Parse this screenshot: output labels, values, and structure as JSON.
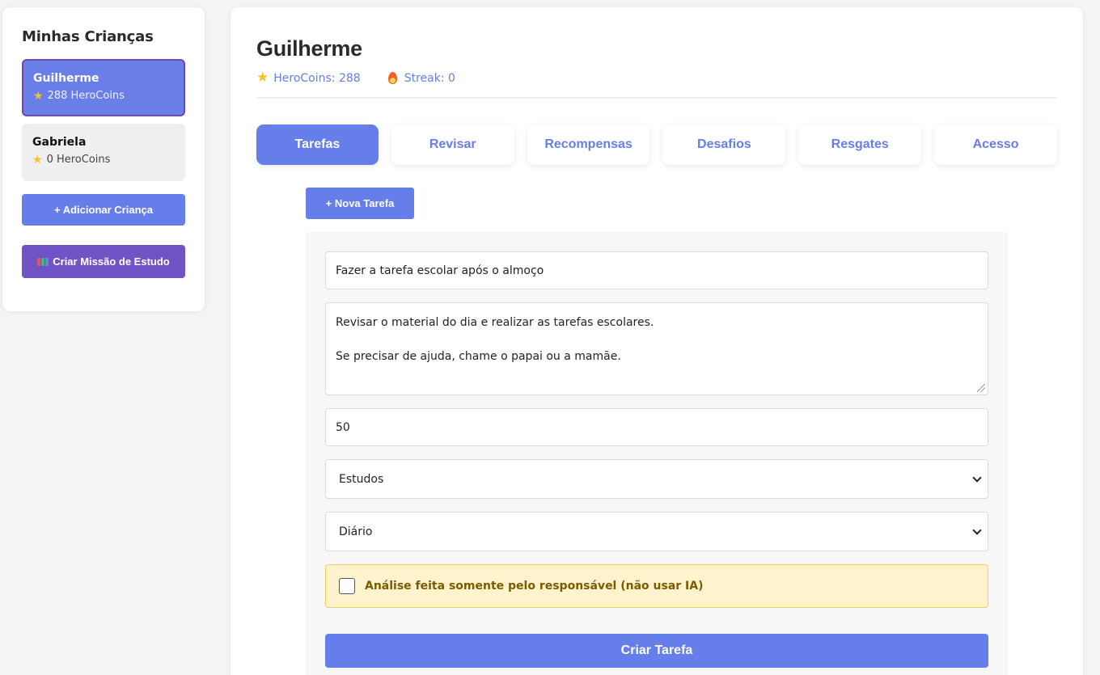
{
  "sidebar": {
    "title": "Minhas Crianças",
    "children": [
      {
        "name": "Guilherme",
        "coins": "288 HeroCoins",
        "active": true
      },
      {
        "name": "Gabriela",
        "coins": "0 HeroCoins",
        "active": false
      }
    ],
    "add_child_label": "+ Adicionar Criança",
    "study_mission_label": "Criar Missão de Estudo"
  },
  "header": {
    "child_name": "Guilherme",
    "herocoins": "HeroCoins: 288",
    "streak": "Streak: 0"
  },
  "tabs": [
    {
      "label": "Tarefas",
      "active": true
    },
    {
      "label": "Revisar"
    },
    {
      "label": "Recompensas"
    },
    {
      "label": "Desafios"
    },
    {
      "label": "Resgates"
    },
    {
      "label": "Acesso"
    }
  ],
  "new_task_label": "+ Nova Tarefa",
  "form": {
    "title_value": "Fazer a tarefa escolar após o almoço",
    "description_lines": [
      "Revisar o material do dia e realizar as tarefas escolares.",
      "",
      "Se precisar de ajuda, chame o papai ou a mamãe."
    ],
    "points_value": "50",
    "category_selected": "Estudos",
    "frequency_selected": "Diário",
    "no_ai_label": "Análise feita somente pelo responsável (não usar IA)",
    "no_ai_checked": false,
    "submit_label": "Criar Tarefa"
  },
  "icons": {
    "coin": "star-icon",
    "streak": "flame-icon",
    "mission": "books-icon"
  },
  "colors": {
    "accent": "#667eea",
    "mission_button": "#6f54c6",
    "warning_bg": "#fff3cd",
    "warning_text": "#7d5a00"
  }
}
